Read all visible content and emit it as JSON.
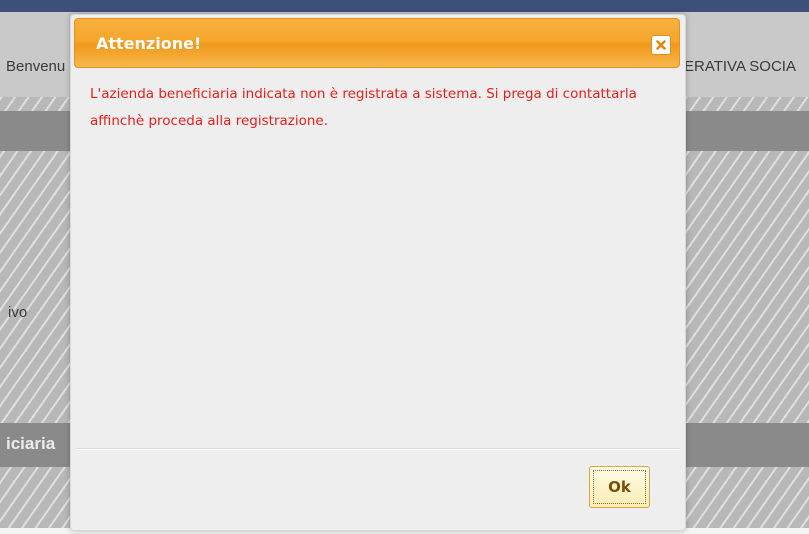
{
  "background": {
    "welcome_text": "Benvenu",
    "org_text": "ERATIVA SOCIA",
    "field_label": "ivo",
    "section_title": "iciaria",
    "top_nav": [
      "",
      "",
      "",
      ""
    ]
  },
  "dialog": {
    "title": "Attenzione!",
    "message": "L'azienda beneficiaria indicata non è registrata a sistema. Si prega di contattarla affinchè proceda alla registrazione.",
    "ok_label": "Ok",
    "close_icon": "close-icon",
    "colors": {
      "title_bar": "#f5a52a",
      "message_text": "#e8201b",
      "ok_button_bg": "#fbecb4"
    }
  }
}
